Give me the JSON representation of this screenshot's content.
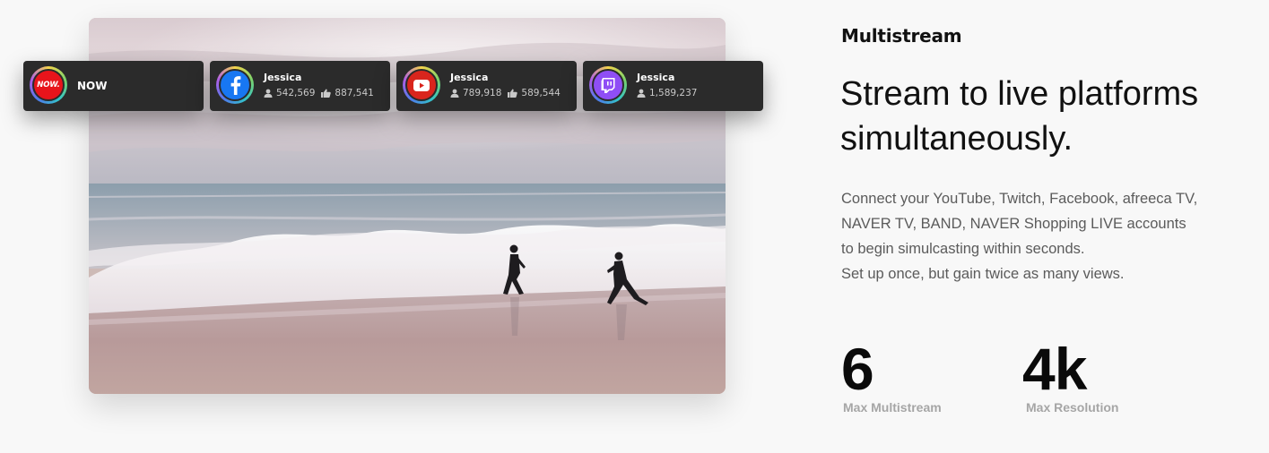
{
  "platforms": [
    {
      "name": "NOW",
      "logo_text": "NOW.",
      "icon": "now-logo-icon",
      "color": "#e8141b"
    },
    {
      "user": "Jessica",
      "icon": "facebook-icon",
      "color": "#1877f2",
      "viewers": "542,569",
      "likes": "887,541"
    },
    {
      "user": "Jessica",
      "icon": "youtube-icon",
      "color": "#d9251d",
      "viewers": "789,918",
      "likes": "589,544"
    },
    {
      "user": "Jessica",
      "icon": "twitch-icon",
      "color": "#8f4ef5",
      "viewers": "1,589,237"
    }
  ],
  "section": {
    "eyebrow": "Multistream",
    "headline_line1": "Stream to live platforms",
    "headline_line2": "simultaneously.",
    "description": [
      "Connect your YouTube, Twitch, Facebook, afreeca TV,",
      "NAVER TV, BAND, NAVER Shopping LIVE accounts",
      "to begin simulcasting within seconds.",
      "Set up once, but gain twice as many views."
    ]
  },
  "metrics": [
    {
      "value": "6",
      "label": "Max Multistream"
    },
    {
      "value": "4k",
      "label": "Max Resolution"
    }
  ]
}
